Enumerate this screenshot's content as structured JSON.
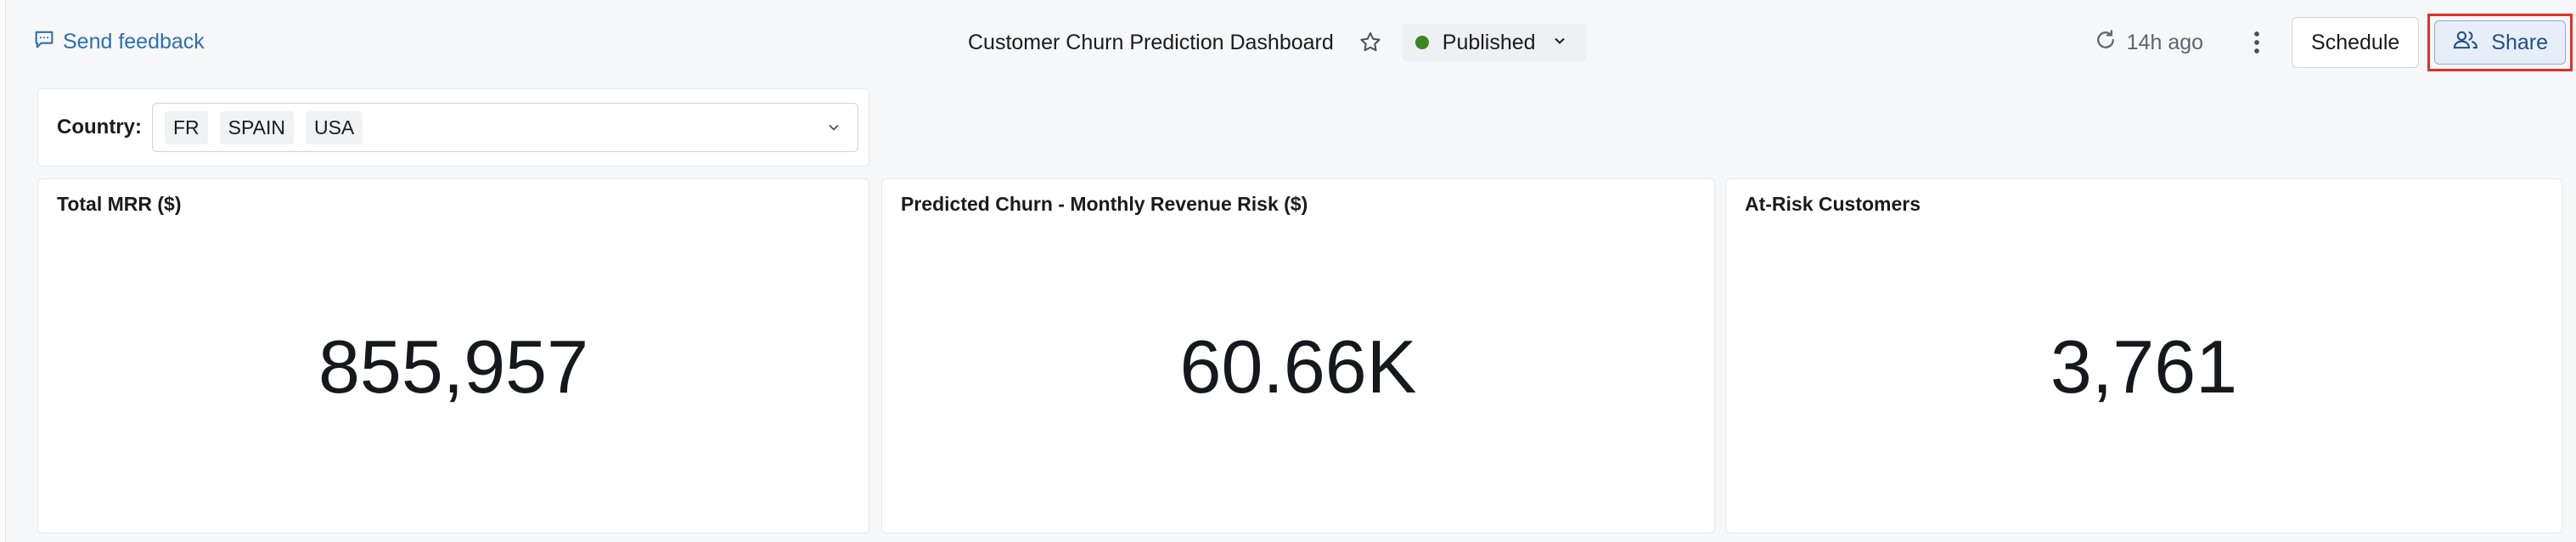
{
  "header": {
    "feedback_label": "Send feedback",
    "dashboard_title": "Customer Churn Prediction Dashboard",
    "status_label": "Published",
    "refresh_label": "14h ago",
    "schedule_label": "Schedule",
    "share_label": "Share"
  },
  "colors": {
    "accent": "#2d6fb3",
    "published_dot": "#3b8522",
    "share_highlight": "#e0302a"
  },
  "filter": {
    "label": "Country:",
    "selected": [
      "FR",
      "SPAIN",
      "USA"
    ]
  },
  "counters": [
    {
      "title": "Total MRR ($)",
      "value": "855,957"
    },
    {
      "title": "Predicted Churn - Monthly Revenue Risk ($)",
      "value": "60.66K"
    },
    {
      "title": "At-Risk Customers",
      "value": "3,761"
    }
  ]
}
